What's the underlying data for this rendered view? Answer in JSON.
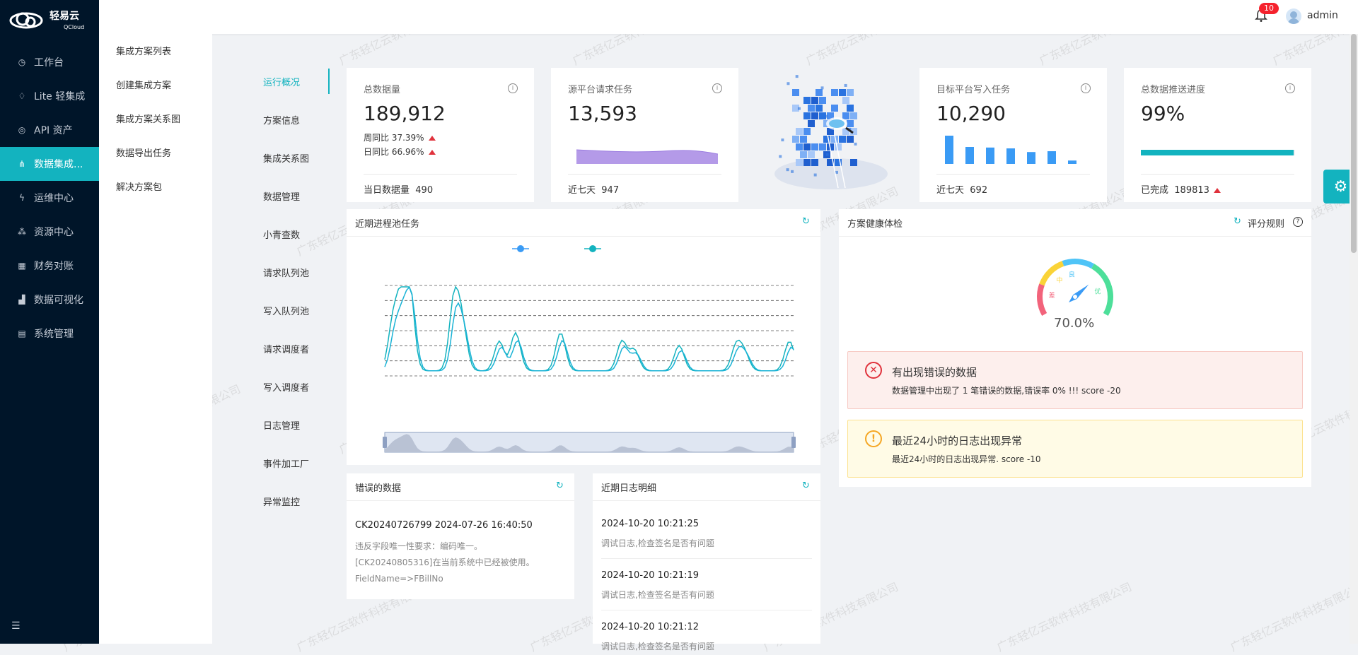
{
  "brand": {
    "name": "轻易云",
    "sub": "QCloud"
  },
  "nav": [
    {
      "label": "工作台",
      "icon": "clock-icon"
    },
    {
      "label": "Lite 轻集成",
      "icon": "bulb-icon"
    },
    {
      "label": "API 资产",
      "icon": "compass-icon"
    },
    {
      "label": "数据集成...",
      "icon": "share-icon"
    },
    {
      "label": "运维中心",
      "icon": "bolt-icon"
    },
    {
      "label": "资源中心",
      "icon": "cluster-icon"
    },
    {
      "label": "财务对账",
      "icon": "calculator-icon"
    },
    {
      "label": "数据可视化",
      "icon": "chart-icon"
    },
    {
      "label": "系统管理",
      "icon": "grid-icon"
    }
  ],
  "submenu": [
    "集成方案列表",
    "创建集成方案",
    "集成方案关系图",
    "数据导出任务",
    "解决方案包"
  ],
  "topbar": {
    "badge": "10",
    "user": "admin"
  },
  "tabs": [
    "运行概况",
    "方案信息",
    "集成关系图",
    "数据管理",
    "小青查数",
    "请求队列池",
    "写入队列池",
    "请求调度者",
    "写入调度者",
    "日志管理",
    "事件加工厂",
    "异常监控"
  ],
  "stats": {
    "total": {
      "title": "总数据量",
      "value": "189,912",
      "week": "周同比 37.39%",
      "day": "日同比 66.96%",
      "foot_label": "当日数据量",
      "foot_value": "490"
    },
    "source": {
      "title": "源平台请求任务",
      "value": "13,593",
      "foot_label": "近七天",
      "foot_value": "947"
    },
    "target": {
      "title": "目标平台写入任务",
      "value": "10,290",
      "foot_label": "近七天",
      "foot_value": "692",
      "bars": [
        1.0,
        0.6,
        0.58,
        0.55,
        0.42,
        0.45,
        0.12
      ]
    },
    "progress": {
      "title": "总数据推送进度",
      "value": "99%",
      "foot_label": "已完成",
      "foot_value": "189813",
      "percent": 0.99
    }
  },
  "pool_panel": {
    "title": "近期进程池任务"
  },
  "health_panel": {
    "title": "方案健康体检",
    "rules": "评分规则",
    "score": "70.0%",
    "gauge_labels": [
      "差",
      "中",
      "良",
      "优"
    ],
    "gauge_value": 0.7
  },
  "alerts": [
    {
      "title": "有出现错误的数据",
      "desc": "数据管理中出现了 1 笔错误的数据,错误率 0% !!! score -20",
      "level": "error"
    },
    {
      "title": "最近24小时的日志出现异常",
      "desc": "最近24小时的日志出现异常. score -10",
      "level": "warning"
    }
  ],
  "error_panel": {
    "title": "错误的数据",
    "entry_title": "CK20240726799 2024-07-26 16:40:50",
    "entry_lines": [
      "违反字段唯一性要求：编码唯一。",
      "[CK20240805316]在当前系统中已经被使用。",
      "FieldName=>FBillNo"
    ]
  },
  "log_panel": {
    "title": "近期日志明细",
    "entries": [
      {
        "time": "2024-10-20 10:21:25",
        "msg": "调试日志,检查签名是否有问题"
      },
      {
        "time": "2024-10-20 10:21:19",
        "msg": "调试日志,检查签名是否有问题"
      },
      {
        "time": "2024-10-20 10:21:12",
        "msg": "调试日志,检查签名是否有问题"
      }
    ]
  },
  "watermark": "广东轻亿云软件科技有限公司",
  "colors": {
    "accent": "#13b3bf",
    "sidebar": "#001529",
    "series1": "#13b3bf",
    "series2": "#1ab3d6",
    "purple": "#b49ae8",
    "blue_bar": "#3a9bf5"
  }
}
